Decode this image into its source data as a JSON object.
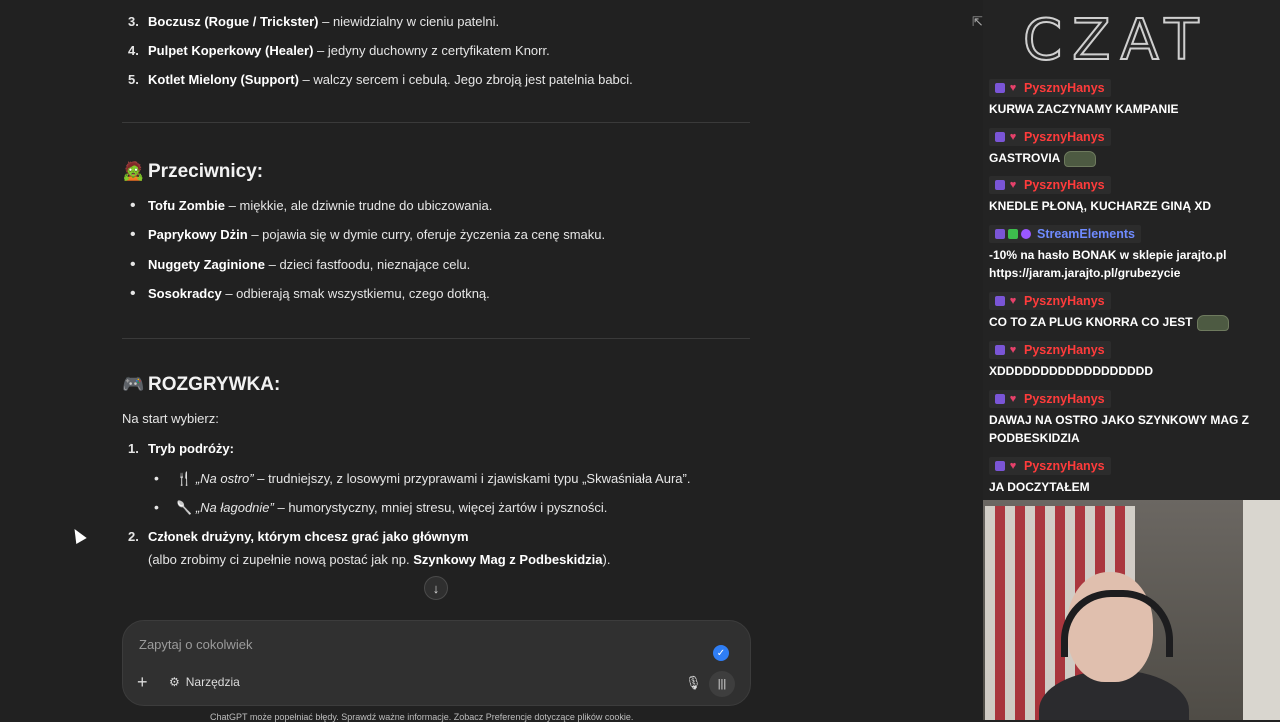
{
  "chat": {
    "top_list": [
      {
        "n": "3.",
        "bold": "Boczusz (Rogue / Trickster)",
        "rest": " – niewidzialny w cieniu patelni."
      },
      {
        "n": "4.",
        "bold": "Pulpet Koperkowy (Healer)",
        "rest": " – jedyny duchowny z certyfikatem Knorr."
      },
      {
        "n": "5.",
        "bold": "Kotlet Mielony (Support)",
        "rest": " – walczy sercem i cebulą. Jego zbroją jest patelnia babci."
      }
    ],
    "section_enemies": {
      "emoji": "🧟",
      "title": "Przeciwnicy:",
      "items": [
        {
          "bold": "Tofu Zombie",
          "rest": " – miękkie, ale dziwnie trudne do ubiczowania."
        },
        {
          "bold": "Paprykowy Dżin",
          "rest": " – pojawia się w dymie curry, oferuje życzenia za cenę smaku."
        },
        {
          "bold": "Nuggety Zaginione",
          "rest": " – dzieci fastfoodu, nieznające celu."
        },
        {
          "bold": "Sosokradcy",
          "rest": " – odbierają smak wszystkiemu, czego dotkną."
        }
      ]
    },
    "section_gameplay": {
      "emoji": "🎮",
      "title": "ROZGRYWKA:",
      "intro": "Na start wybierz:",
      "item1": {
        "n": "1.",
        "bold": "Tryb podróży:"
      },
      "sub": [
        {
          "icon": "🍴",
          "italic": "„Na ostro”",
          "rest": " – trudniejszy, z losowymi przyprawami i zjawiskami typu „Skwaśniała Aura”."
        },
        {
          "icon": "🥄",
          "italic": "„Na łagodnie”",
          "rest": " – humorystyczny, mniej stresu, więcej żartów i pyszności."
        }
      ],
      "item2": {
        "n": "2.",
        "bold": "Członek drużyny, którym chcesz grać jako głównym"
      },
      "item2_line2_pre": "(albo zrobimy ci zupełnie nową postać jak np. ",
      "item2_line2_bold": "Szynkowy Mag z Podbeskidzia",
      "item2_line2_post": ")."
    },
    "scroll_down": "↓",
    "composer": {
      "placeholder": "Zapytaj o cokolwiek",
      "plus": "+",
      "tools_icon": "⚙",
      "tools_label": "Narzędzia",
      "mic": "🎙",
      "voice": "|||",
      "check": "✓"
    },
    "disclaimer": "ChatGPT może popełniać błędy. Sprawdź ważne informacje. Zobacz Preferencje dotyczące plików cookie.",
    "share_icon": "⇱"
  },
  "stream": {
    "logo": "CZAT",
    "messages": [
      {
        "user": "PysznyHanys",
        "color": "#ff3b3b",
        "badges": [
          "sub",
          "heart"
        ],
        "text": "KURWA ZACZYNAMY KAMPANIE",
        "emote": false
      },
      {
        "user": "PysznyHanys",
        "color": "#ff3b3b",
        "badges": [
          "sub",
          "heart"
        ],
        "text": "GASTROVIA",
        "emote": true
      },
      {
        "user": "PysznyHanys",
        "color": "#ff3b3b",
        "badges": [
          "sub",
          "heart"
        ],
        "text": "KNEDLE PŁONĄ, KUCHARZE GINĄ XD",
        "emote": false
      },
      {
        "user": "StreamElements",
        "color": "#6f8bff",
        "badges": [
          "sub",
          "green",
          "purple"
        ],
        "text": "-10% na hasło BONAK w sklepie jarajto.pl https://jaram.jarajto.pl/grubezycie",
        "emote": false
      },
      {
        "user": "PysznyHanys",
        "color": "#ff3b3b",
        "badges": [
          "sub",
          "heart"
        ],
        "text": "CO TO ZA PLUG KNORRA CO JEST",
        "emote": true
      },
      {
        "user": "PysznyHanys",
        "color": "#ff3b3b",
        "badges": [
          "sub",
          "heart"
        ],
        "text": "XDDDDDDDDDDDDDDDDDD",
        "emote": false
      },
      {
        "user": "PysznyHanys",
        "color": "#ff3b3b",
        "badges": [
          "sub",
          "heart"
        ],
        "text": "DAWAJ NA OSTRO JAKO SZYNKOWY MAG Z PODBESKIDZIA",
        "emote": false
      },
      {
        "user": "PysznyHanys",
        "color": "#ff3b3b",
        "badges": [
          "sub",
          "heart"
        ],
        "text": "JA DOCZYTAŁEM",
        "emote": false
      }
    ]
  }
}
